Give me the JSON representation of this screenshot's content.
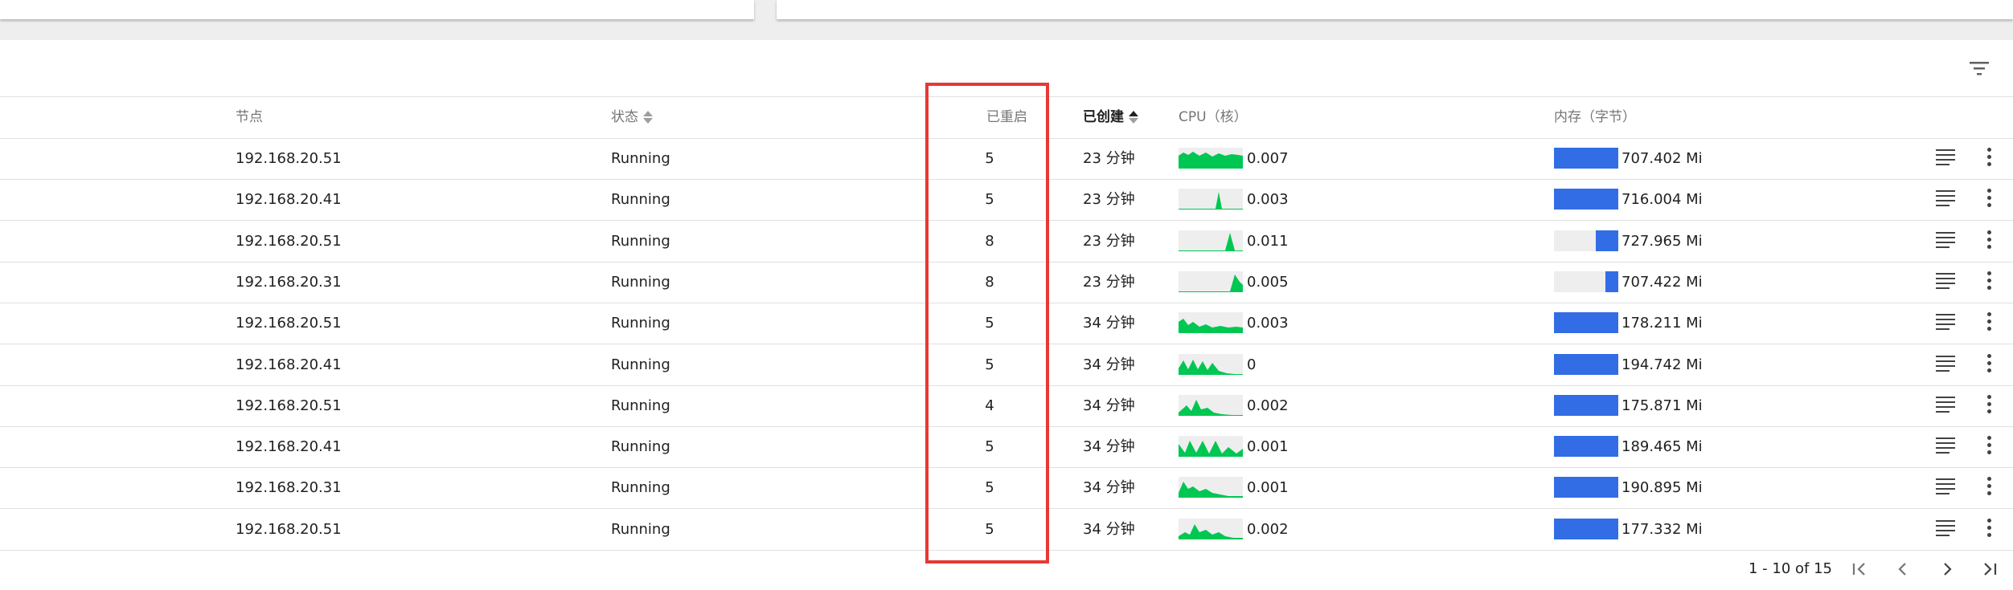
{
  "headers": {
    "node": "节点",
    "status": "状态",
    "restarts": "已重启",
    "created": "已创建",
    "cpu": "CPU（核）",
    "memory": "内存（字节）"
  },
  "rows": [
    {
      "node": "192.168.20.51",
      "status": "Running",
      "restarts": "5",
      "created": "23 分钟",
      "cpu": "0.007",
      "memory": "707.402 Mi",
      "mem_fill": 1.0
    },
    {
      "node": "192.168.20.41",
      "status": "Running",
      "restarts": "5",
      "created": "23 分钟",
      "cpu": "0.003",
      "memory": "716.004 Mi",
      "mem_fill": 1.0
    },
    {
      "node": "192.168.20.51",
      "status": "Running",
      "restarts": "8",
      "created": "23 分钟",
      "cpu": "0.011",
      "memory": "727.965 Mi",
      "mem_fill": 0.35
    },
    {
      "node": "192.168.20.31",
      "status": "Running",
      "restarts": "8",
      "created": "23 分钟",
      "cpu": "0.005",
      "memory": "707.422 Mi",
      "mem_fill": 0.2
    },
    {
      "node": "192.168.20.51",
      "status": "Running",
      "restarts": "5",
      "created": "34 分钟",
      "cpu": "0.003",
      "memory": "178.211 Mi",
      "mem_fill": 1.0
    },
    {
      "node": "192.168.20.41",
      "status": "Running",
      "restarts": "5",
      "created": "34 分钟",
      "cpu": "0",
      "memory": "194.742 Mi",
      "mem_fill": 1.0
    },
    {
      "node": "192.168.20.51",
      "status": "Running",
      "restarts": "4",
      "created": "34 分钟",
      "cpu": "0.002",
      "memory": "175.871 Mi",
      "mem_fill": 1.0
    },
    {
      "node": "192.168.20.41",
      "status": "Running",
      "restarts": "5",
      "created": "34 分钟",
      "cpu": "0.001",
      "memory": "189.465 Mi",
      "mem_fill": 1.0
    },
    {
      "node": "192.168.20.31",
      "status": "Running",
      "restarts": "5",
      "created": "34 分钟",
      "cpu": "0.001",
      "memory": "190.895 Mi",
      "mem_fill": 1.0
    },
    {
      "node": "192.168.20.51",
      "status": "Running",
      "restarts": "5",
      "created": "34 分钟",
      "cpu": "0.002",
      "memory": "177.332 Mi",
      "mem_fill": 1.0
    }
  ],
  "pagination": {
    "range": "1 - 10 of 15"
  },
  "icons": {
    "filter": "filter-list-icon",
    "logs": "logs-icon",
    "more": "more-vert-icon",
    "first": "first-page-icon",
    "prev": "chevron-left-icon",
    "next": "chevron-right-icon",
    "last": "last-page-icon"
  },
  "colors": {
    "cpu_spark": "#00c752",
    "memory_bar": "#326de6",
    "highlight_box": "#e53935"
  }
}
